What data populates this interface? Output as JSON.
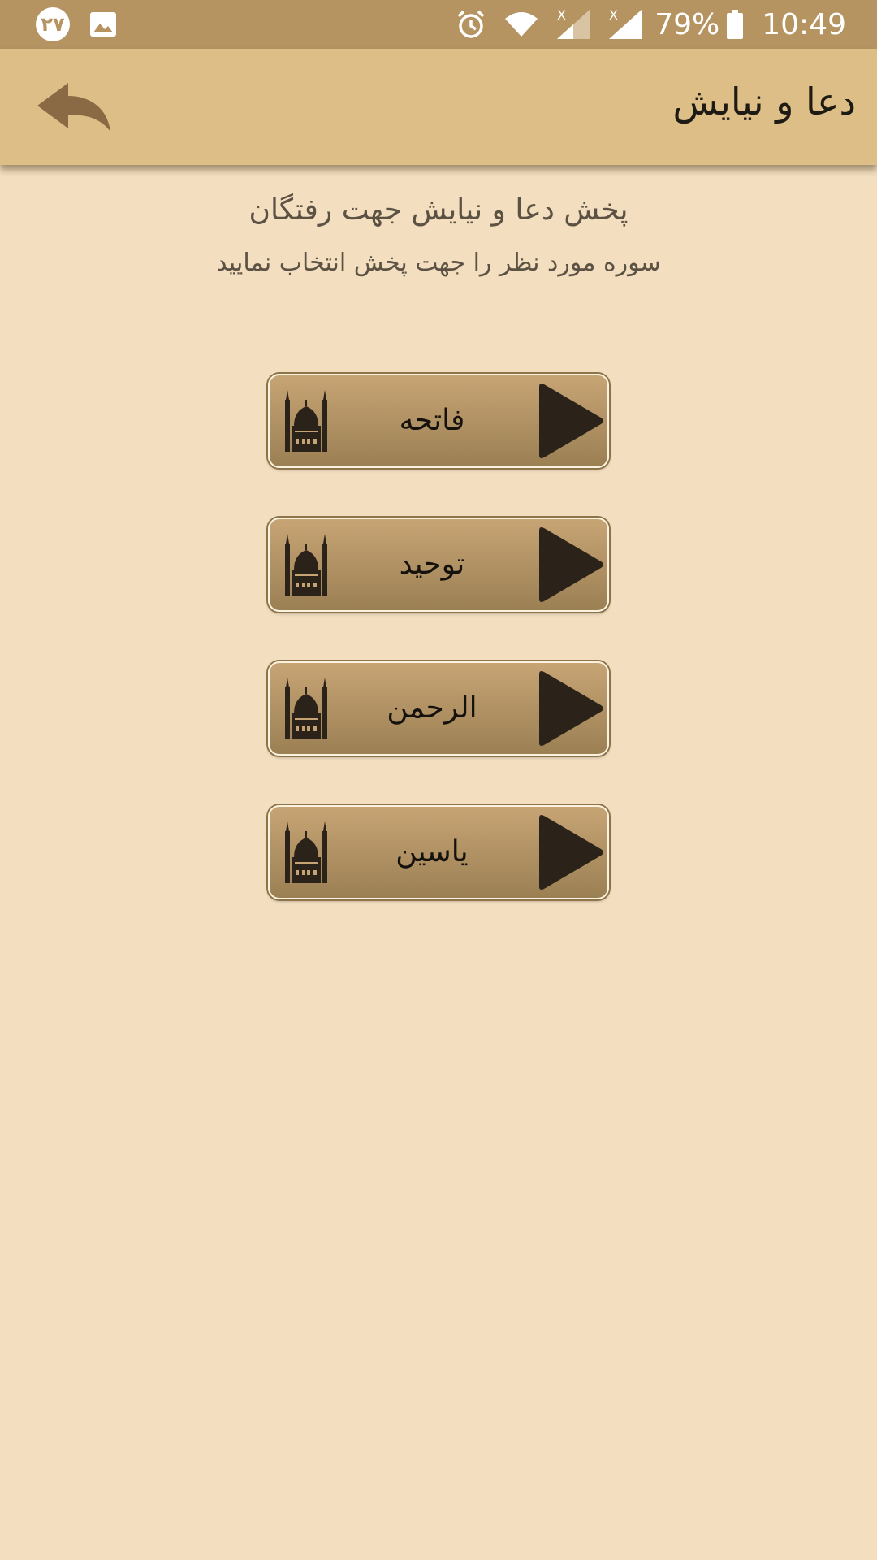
{
  "status_bar": {
    "notification_badge": "۲۷",
    "battery_percent": "79%",
    "time": "10:49",
    "icons": [
      "image-icon",
      "alarm-icon",
      "wifi-icon",
      "signal-x-icon",
      "signal-x-icon",
      "battery-icon"
    ]
  },
  "header": {
    "title": "دعا و نیایش",
    "back_icon": "reply-arrow-icon"
  },
  "intro": {
    "title": "پخش دعا و نیایش جهت رفتگان",
    "subtitle": "سوره مورد نظر را جهت پخش انتخاب نمایید"
  },
  "items": [
    {
      "label": "فاتحه"
    },
    {
      "label": "توحید"
    },
    {
      "label": "الرحمن"
    },
    {
      "label": "یاسین"
    }
  ],
  "colors": {
    "status_bar": "#b59462",
    "app_bar": "#dcbe86",
    "background": "#f3dfc0",
    "button_top": "#c7a474",
    "button_bottom": "#9b8054",
    "icon_dark": "#2b2219"
  }
}
